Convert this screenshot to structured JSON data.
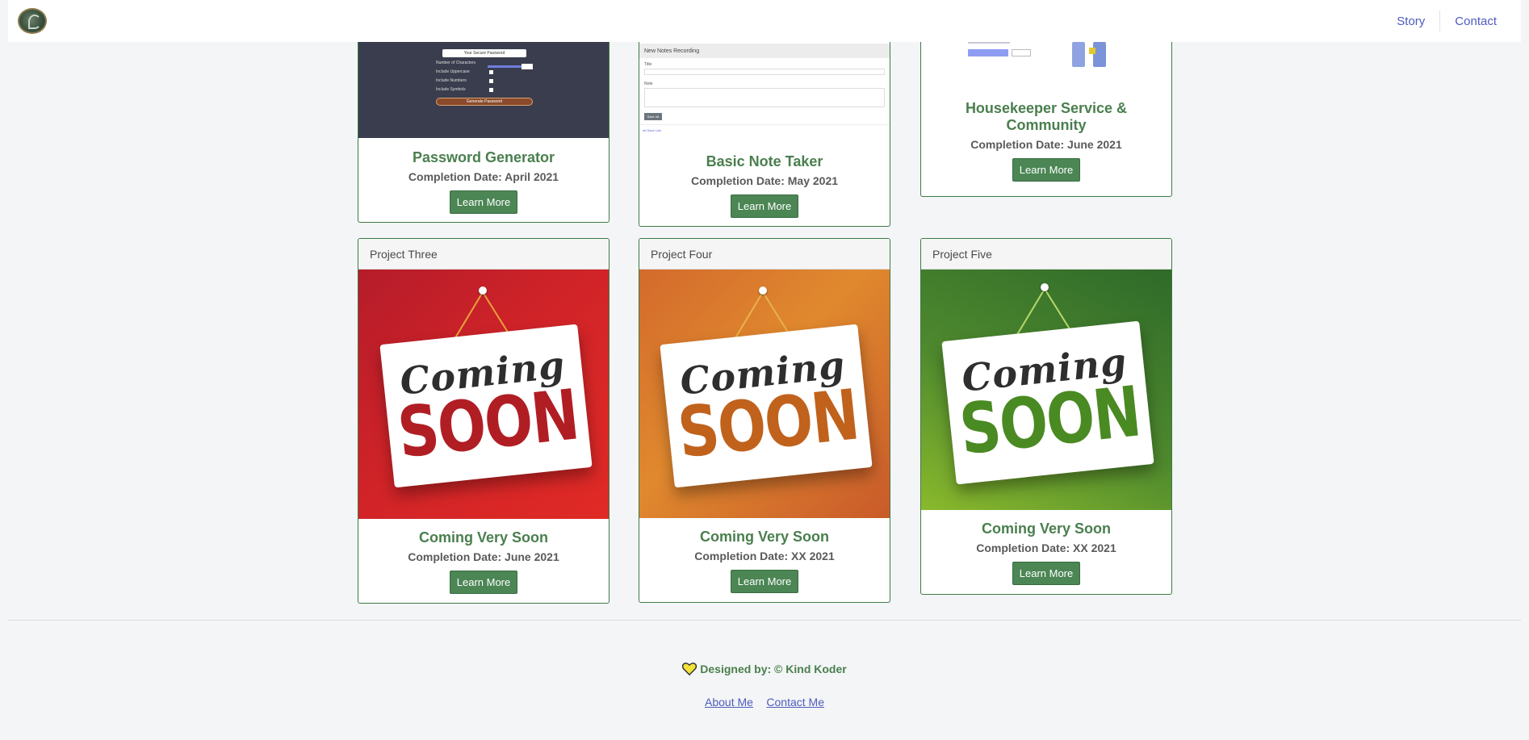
{
  "nav": {
    "links": [
      "Story",
      "Contact"
    ]
  },
  "projects_top": [
    {
      "title": "Password Generator",
      "date": "Completion Date: April 2021",
      "button": "Learn More",
      "thumb": {
        "box_text": "Your Secure Password",
        "rows": [
          "Number of Characters",
          "Include Uppercase",
          "Include Numbers",
          "Include Symbols"
        ],
        "generate": "Generate Password"
      }
    },
    {
      "title": "Basic Note Taker",
      "date": "Completion Date: May 2021",
      "button": "Learn More",
      "thumb": {
        "bar": "New Notes Recording",
        "title_label": "Title",
        "note_label": "Note",
        "save": "Save ntt",
        "link": "ntt Save Link"
      }
    },
    {
      "title": "Housekeeper Service & Community",
      "date": "Completion Date: June 2021",
      "button": "Learn More"
    }
  ],
  "projects_bottom": [
    {
      "header": "Project Three",
      "title": "Coming Very Soon",
      "date": "Completion Date: June 2021",
      "button": "Learn More",
      "art": {
        "coming": "Coming",
        "soon": "SOON"
      }
    },
    {
      "header": "Project Four",
      "title": "Coming Very Soon",
      "date": "Completion Date: XX 2021",
      "button": "Learn More",
      "art": {
        "coming": "Coming",
        "soon": "SOON"
      }
    },
    {
      "header": "Project Five",
      "title": "Coming Very Soon",
      "date": "Completion Date: XX 2021",
      "button": "Learn More",
      "art": {
        "coming": "Coming",
        "soon": "SOON"
      }
    }
  ],
  "footer": {
    "credit": "Designed by: © Kind Koder",
    "links": [
      "About Me",
      "Contact Me"
    ]
  },
  "colors": {
    "accent_green": "#4b8654",
    "link_blue": "#4f5bbd",
    "soon_red": "#d42424",
    "soon_orange": "#d9762a",
    "soon_green": "#4e8a2e"
  },
  "icons": [
    "logo-icon",
    "heart-icon"
  ]
}
